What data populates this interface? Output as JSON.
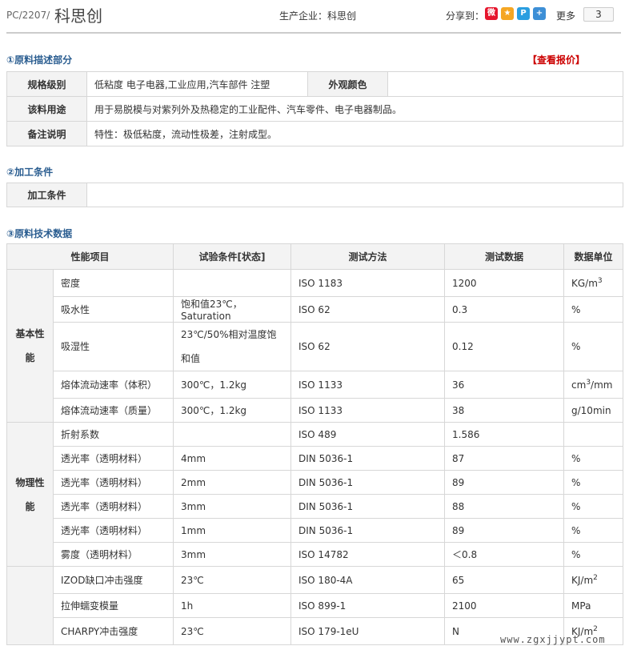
{
  "header": {
    "code": "PC/2207/",
    "name": "科思创",
    "manufacturer": "生产企业：科思创",
    "share_label": "分享到：",
    "more_label": "更多",
    "share_count": "3",
    "share_icons": [
      "weibo-icon",
      "qzone-icon",
      "tencent-weibo-icon",
      "more-plus-icon"
    ]
  },
  "section1": {
    "title": "①原料描述部分",
    "quote_link": "【查看报价】",
    "rows": {
      "grade_label": "规格级别",
      "grade_value": "低粘度 电子电器,工业应用,汽车部件 注塑",
      "color_label": "外观颜色",
      "color_value": "",
      "use_label": "该料用途",
      "use_value": "用于易脱模与对紫列外及热稳定的工业配件、汽车零件、电子电器制品。",
      "remark_label": "备注说明",
      "remark_value": "特性：极低粘度，流动性极差，注射成型。"
    }
  },
  "section2": {
    "title": "②加工条件",
    "label": "加工条件",
    "value": ""
  },
  "section3": {
    "title": "③原料技术数据",
    "headers": [
      "性能项目",
      "试验条件[状态]",
      "测试方法",
      "测试数据",
      "数据单位"
    ],
    "groups": {
      "basic": "基本性能",
      "physical": "物理性能"
    },
    "rows": [
      {
        "item": "密度",
        "cond": "",
        "method": "ISO 1183",
        "value": "1200",
        "unit": "KG/m",
        "sup": "3"
      },
      {
        "item": "吸水性",
        "cond": "饱和值23℃，Saturation",
        "method": "ISO 62",
        "value": "0.3",
        "unit": "%",
        "sup": ""
      },
      {
        "item": "吸湿性",
        "cond": "23℃/50%相对温度饱和值",
        "method": "ISO 62",
        "value": "0.12",
        "unit": "%",
        "sup": ""
      },
      {
        "item": "熔体流动速率（体积）",
        "cond": "300℃，1.2kg",
        "method": "ISO 1133",
        "value": "36",
        "unit": "cm",
        "sup": "3",
        "unit_tail": "/mm"
      },
      {
        "item": "熔体流动速率（质量）",
        "cond": "300℃，1.2kg",
        "method": "ISO 1133",
        "value": "38",
        "unit": "g/10min",
        "sup": ""
      },
      {
        "item": "折射系数",
        "cond": "",
        "method": "ISO 489",
        "value": "1.586",
        "unit": "",
        "sup": ""
      },
      {
        "item": "透光率（透明材料）",
        "cond": "4mm",
        "method": "DIN 5036-1",
        "value": "87",
        "unit": "%",
        "sup": ""
      },
      {
        "item": "透光率（透明材料）",
        "cond": "2mm",
        "method": "DIN 5036-1",
        "value": "89",
        "unit": "%",
        "sup": ""
      },
      {
        "item": "透光率（透明材料）",
        "cond": "3mm",
        "method": "DIN 5036-1",
        "value": "88",
        "unit": "%",
        "sup": ""
      },
      {
        "item": "透光率（透明材料）",
        "cond": "1mm",
        "method": "DIN 5036-1",
        "value": "89",
        "unit": "%",
        "sup": ""
      },
      {
        "item": "雾度（透明材料）",
        "cond": "3mm",
        "method": "ISO 14782",
        "value": "＜0.8",
        "unit": "%",
        "sup": ""
      },
      {
        "item": "IZOD缺口冲击强度",
        "cond": "23℃",
        "method": "ISO 180-4A",
        "value": "65",
        "unit": "KJ/m",
        "sup": "2"
      },
      {
        "item": "拉伸蠕变模量",
        "cond": "1h",
        "method": "ISO 899-1",
        "value": "2100",
        "unit": "MPa",
        "sup": ""
      },
      {
        "item": "CHARPY冲击强度",
        "cond": "23℃",
        "method": "ISO 179-1eU",
        "value": "N",
        "unit": "KJ/m",
        "sup": "2"
      }
    ]
  },
  "watermark": "www.zgxjjypt.com",
  "colors": {
    "section_title": "#2a5d90",
    "quote_link": "#cc0000",
    "label_bg": "#f3f3f3",
    "border": "#d7d7d7"
  }
}
